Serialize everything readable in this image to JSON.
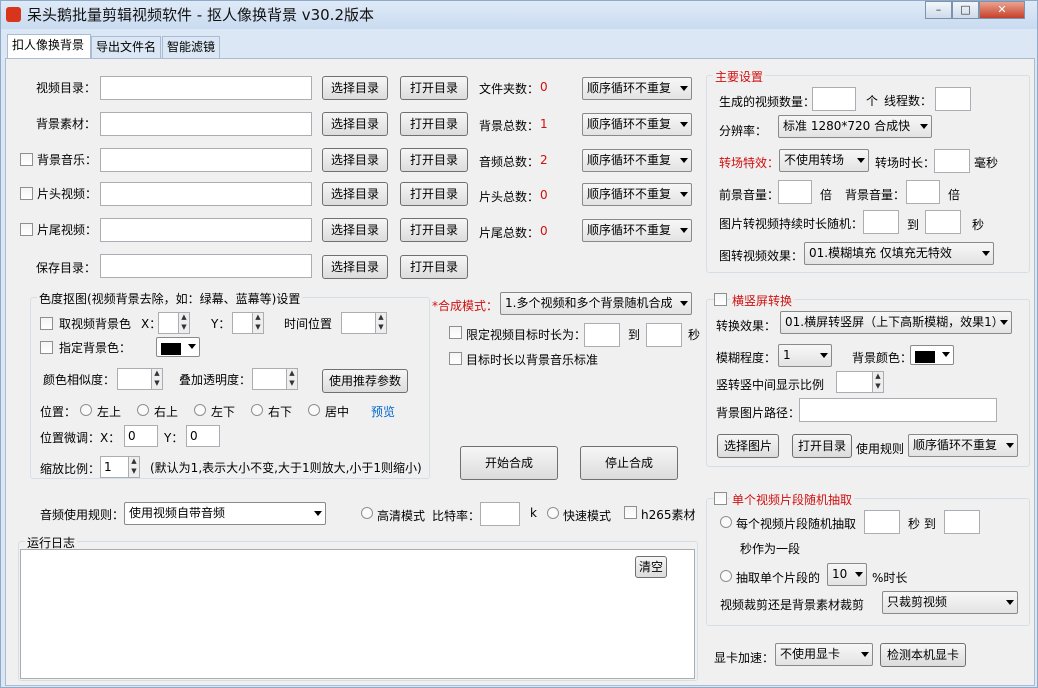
{
  "window": {
    "title": "呆头鹅批量剪辑视频软件 - 抠人像换背景  v30.2版本",
    "min_glyph": "–",
    "max_glyph": "□",
    "close_glyph": "✕"
  },
  "tabs": [
    "扣人像换背景",
    "导出文件名",
    "智能滤镜"
  ],
  "dir_section": {
    "rows": [
      {
        "label": "视频目录：",
        "has_checkbox": false,
        "value": "",
        "select_label": "选择目录",
        "open_label": "打开目录",
        "count_label": "文件夹数：",
        "count": "0",
        "mode": "顺序循环不重复"
      },
      {
        "label": "背景素材：",
        "has_checkbox": false,
        "value": "",
        "select_label": "选择目录",
        "open_label": "打开目录",
        "count_label": "背景总数：",
        "count": "1",
        "mode": "顺序循环不重复"
      },
      {
        "label": "背景音乐：",
        "has_checkbox": true,
        "value": "",
        "select_label": "选择目录",
        "open_label": "打开目录",
        "count_label": "音频总数：",
        "count": "2",
        "mode": "顺序循环不重复"
      },
      {
        "label": "片头视频：",
        "has_checkbox": true,
        "value": "",
        "select_label": "选择目录",
        "open_label": "打开目录",
        "count_label": "片头总数：",
        "count": "0",
        "mode": "顺序循环不重复"
      },
      {
        "label": "片尾视频：",
        "has_checkbox": true,
        "value": "",
        "select_label": "选择目录",
        "open_label": "打开目录",
        "count_label": "片尾总数：",
        "count": "0",
        "mode": "顺序循环不重复"
      }
    ],
    "save": {
      "label": "保存目录：",
      "value": "",
      "select_label": "选择目录",
      "open_label": "打开目录"
    }
  },
  "chroma": {
    "title": "色度抠图(视频背景去除，如：绿幕、蓝幕等)设置",
    "take_bg_color": "取视频背景色",
    "x_label": "X：",
    "y_label": "Y：",
    "time_pos": "时间位置",
    "assign_bg_color": "指定背景色：",
    "similarity": "颜色相似度：",
    "overlay_alpha": "叠加透明度：",
    "recommend_btn": "使用推荐参数",
    "position_label": "位置：",
    "positions": [
      "左上",
      "右上",
      "左下",
      "右下",
      "居中"
    ],
    "preview": "预览",
    "fine_tune": "位置微调：X：",
    "fine_x": "0",
    "fine_y_label": "Y：",
    "fine_y": "0",
    "scale_label": "缩放比例：",
    "scale": "1",
    "scale_hint": "(默认为1,表示大小不变,大于1则放大,小于1则缩小)"
  },
  "synth": {
    "mode_label": "*合成模式：",
    "mode": "1.多个视频和多个背景随机合成",
    "limit_label": "限定视频目标时长为：",
    "to": "到",
    "sec": "秒",
    "bgm_target": "目标时长以背景音乐标准",
    "start": "开始合成",
    "stop": "停止合成"
  },
  "audio": {
    "label": "音频使用规则：",
    "value": "使用视频自带音频",
    "hd_mode": "高清模式",
    "bitrate_label": "比特率：",
    "bitrate_unit": "k",
    "fast_mode": "快速模式",
    "h265": "h265素材"
  },
  "log": {
    "title": "运行日志",
    "clear": "清空"
  },
  "main_settings": {
    "title": "主要设置",
    "gen_count": "生成的视频数量：",
    "unit_ge": "个",
    "threads": "线程数：",
    "resolution_label": "分辨率：",
    "resolution": "标准 1280*720 合成快",
    "transition_label": "转场特效：",
    "transition": "不使用转场",
    "transition_dur": "转场时长：",
    "ms": "毫秒",
    "fg_volume": "前景音量：",
    "times": "倍",
    "bg_volume": "背景音量：",
    "img_dur": "图片转视频持续时长随机：",
    "to": "到",
    "sec": "秒",
    "img_effect_label": "图转视频效果：",
    "img_effect": "01.模糊填充 仅填充无特效"
  },
  "orient": {
    "title": "横竖屏转换",
    "effect_label": "转换效果：",
    "effect": "01.横屏转竖屏（上下高斯模糊，效果1）",
    "blur_label": "模糊程度：",
    "blur": "1",
    "bgcolor_label": "背景颜色：",
    "ratio_label": "竖转竖中间显示比例",
    "bgimg_label": "背景图片路径：",
    "select_img": "选择图片",
    "open_dir": "打开目录",
    "rule_label": "使用规则",
    "rule": "顺序循环不重复"
  },
  "segment": {
    "title": "单个视频片段随机抽取",
    "each_label": "每个视频片段随机抽取",
    "sec_to": "秒 到",
    "as_segment": "秒作为一段",
    "single_label": "抽取单个片段的",
    "percent": "10",
    "percent_suffix": "%时长",
    "crop_label": "视频裁剪还是背景素材裁剪",
    "crop": "只裁剪视频"
  },
  "gpu": {
    "label": "显卡加速：",
    "value": "不使用显卡",
    "detect": "检测本机显卡"
  }
}
